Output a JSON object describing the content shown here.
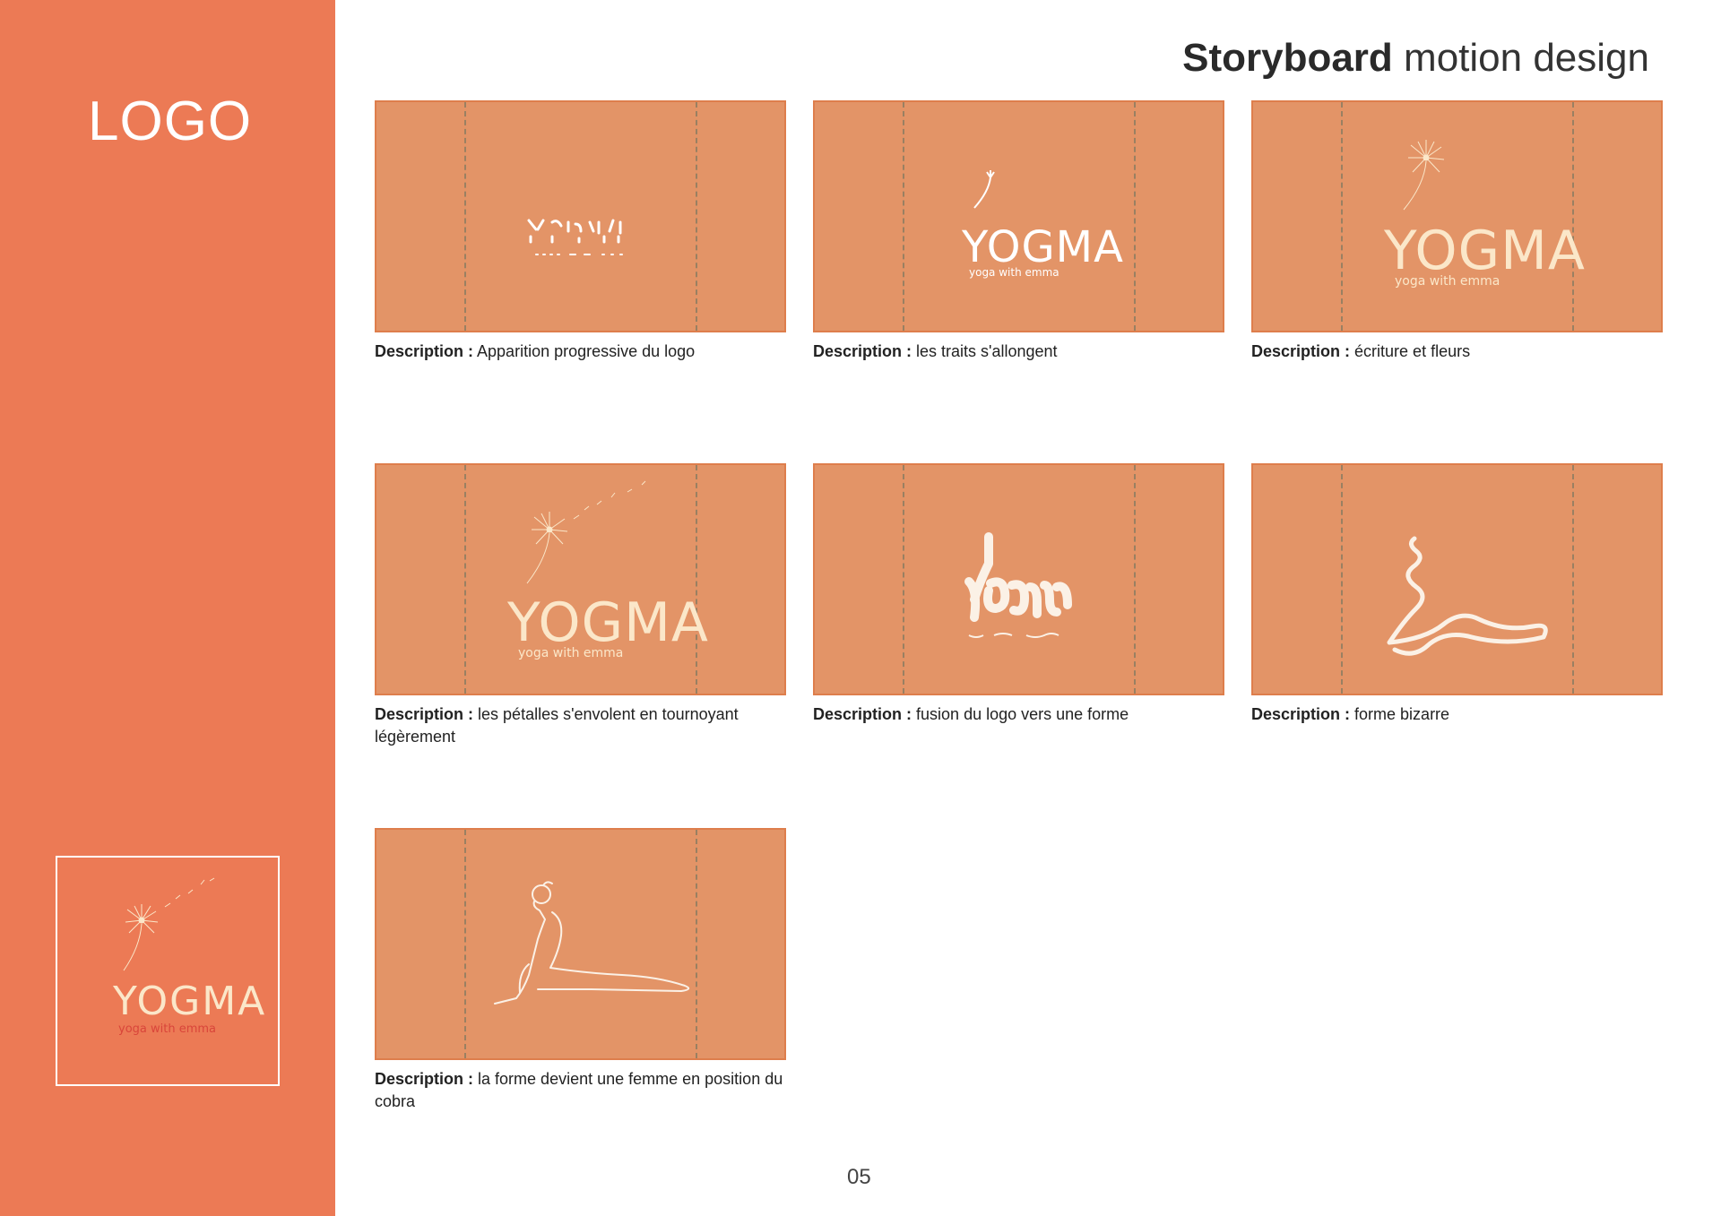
{
  "sidebar": {
    "title": "LOGO",
    "logo": {
      "wordmark": "YOGMA",
      "tagline": "yoga with emma",
      "accent": "#d9453a"
    }
  },
  "header": {
    "strong": "Storyboard",
    "light": "motion design"
  },
  "frames": [
    {
      "label": "Description :",
      "text": "Apparition progressive du logo"
    },
    {
      "label": "Description :",
      "text": "les traits s'allongent",
      "wordmark": "YOGMA",
      "tagline": "yoga with emma"
    },
    {
      "label": "Description :",
      "text": "écriture et fleurs",
      "wordmark": "YOGMA",
      "tagline": "yoga with emma"
    },
    {
      "label": "Description :",
      "text": "les pétalles s'envolent en tournoyant légèrement",
      "wordmark": "YOGMA",
      "tagline": "yoga with emma"
    },
    {
      "label": "Description :",
      "text": "fusion du logo vers une forme"
    },
    {
      "label": "Description :",
      "text": "forme bizarre"
    },
    {
      "label": "Description :",
      "text": "la forme devient une femme en position du cobra"
    }
  ],
  "page_number": "05",
  "colors": {
    "sidebar": "#ec7a55",
    "frame": "#e39467",
    "frame_border": "#de7e4c"
  }
}
